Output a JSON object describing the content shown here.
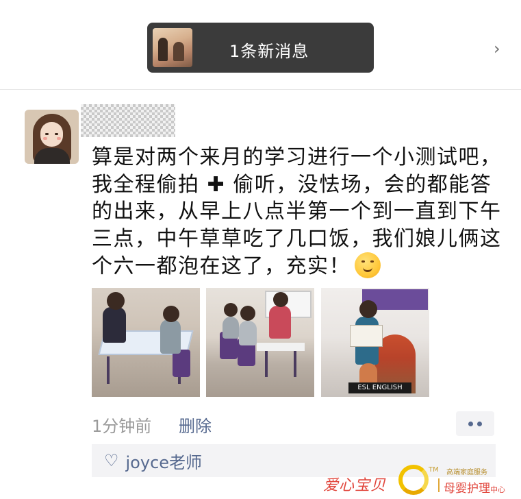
{
  "banner": {
    "text": "1条新消息",
    "chevron": "›"
  },
  "post": {
    "text_before": "算是对两个来月的学习进行一个小测试吧，我全程偷拍",
    "plus": "✚",
    "text_after": "偷听，没怯场，会的都能答的出来，从早上八点半第一个到一直到下午三点，中午草草吃了几口饭，我们娘儿俩这个六一都泡在这了，充实！",
    "emoji": "hugging-face-emoji",
    "photo_caption": "ESL ENGLISH"
  },
  "footer": {
    "time": "1分钟前",
    "delete": "删除"
  },
  "likes": {
    "icon": "heart-outline-icon",
    "name": "joyce老师"
  },
  "watermark": {
    "left": "爱心宝贝",
    "tm": "TM",
    "sub1": "高端家庭服务",
    "sub2_main": "母婴护理",
    "sub2_small": "中心"
  },
  "colors": {
    "link": "#56698f",
    "banner_bg": "#3b3b3b",
    "watermark_red": "#e1463c"
  }
}
